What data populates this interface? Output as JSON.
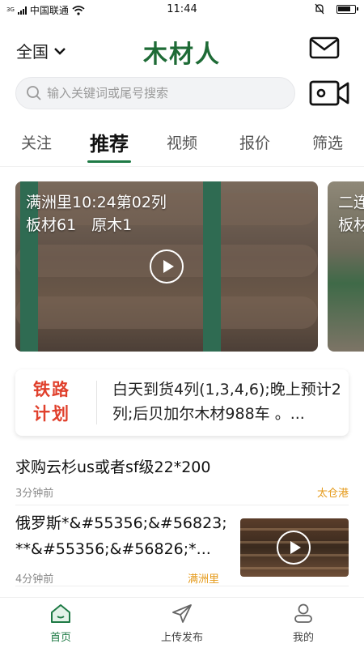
{
  "status_bar": {
    "carrier": "中国联通",
    "signal_type": "3G",
    "time": "11:44"
  },
  "header": {
    "region": "全国",
    "logo": "木材人",
    "brand_color": "#1e6b36"
  },
  "search": {
    "placeholder": "输入关键词或尾号搜索"
  },
  "tabs": [
    {
      "label": "关注"
    },
    {
      "label": "推荐"
    },
    {
      "label": "视频"
    },
    {
      "label": "报价"
    },
    {
      "label": "筛选"
    }
  ],
  "active_tab": "推荐",
  "videos": [
    {
      "line1": "满洲里10:24第02列",
      "line2": "板材61　原木1"
    },
    {
      "line1": "二连",
      "line2": "板材"
    }
  ],
  "rail_plan": {
    "tag": "铁路计划",
    "text": "白天到货4列(1,3,4,6);晚上预计2列;后贝加尔木材988车 。..."
  },
  "news": [
    {
      "title": "求购云杉us或者sf级22*200",
      "time": "3分钟前",
      "location": "太仓港"
    },
    {
      "title": "俄罗斯*&#55356;&#56823;**&#55356;&#56826;*...",
      "time": "4分钟前",
      "location": "满洲里"
    }
  ],
  "bottom_nav": [
    {
      "label": "首页"
    },
    {
      "label": "上传发布"
    },
    {
      "label": "我的"
    }
  ],
  "colors": {
    "accent": "#1e7a45",
    "plan_red": "#e0402c",
    "location_orange": "#e59a1a"
  }
}
